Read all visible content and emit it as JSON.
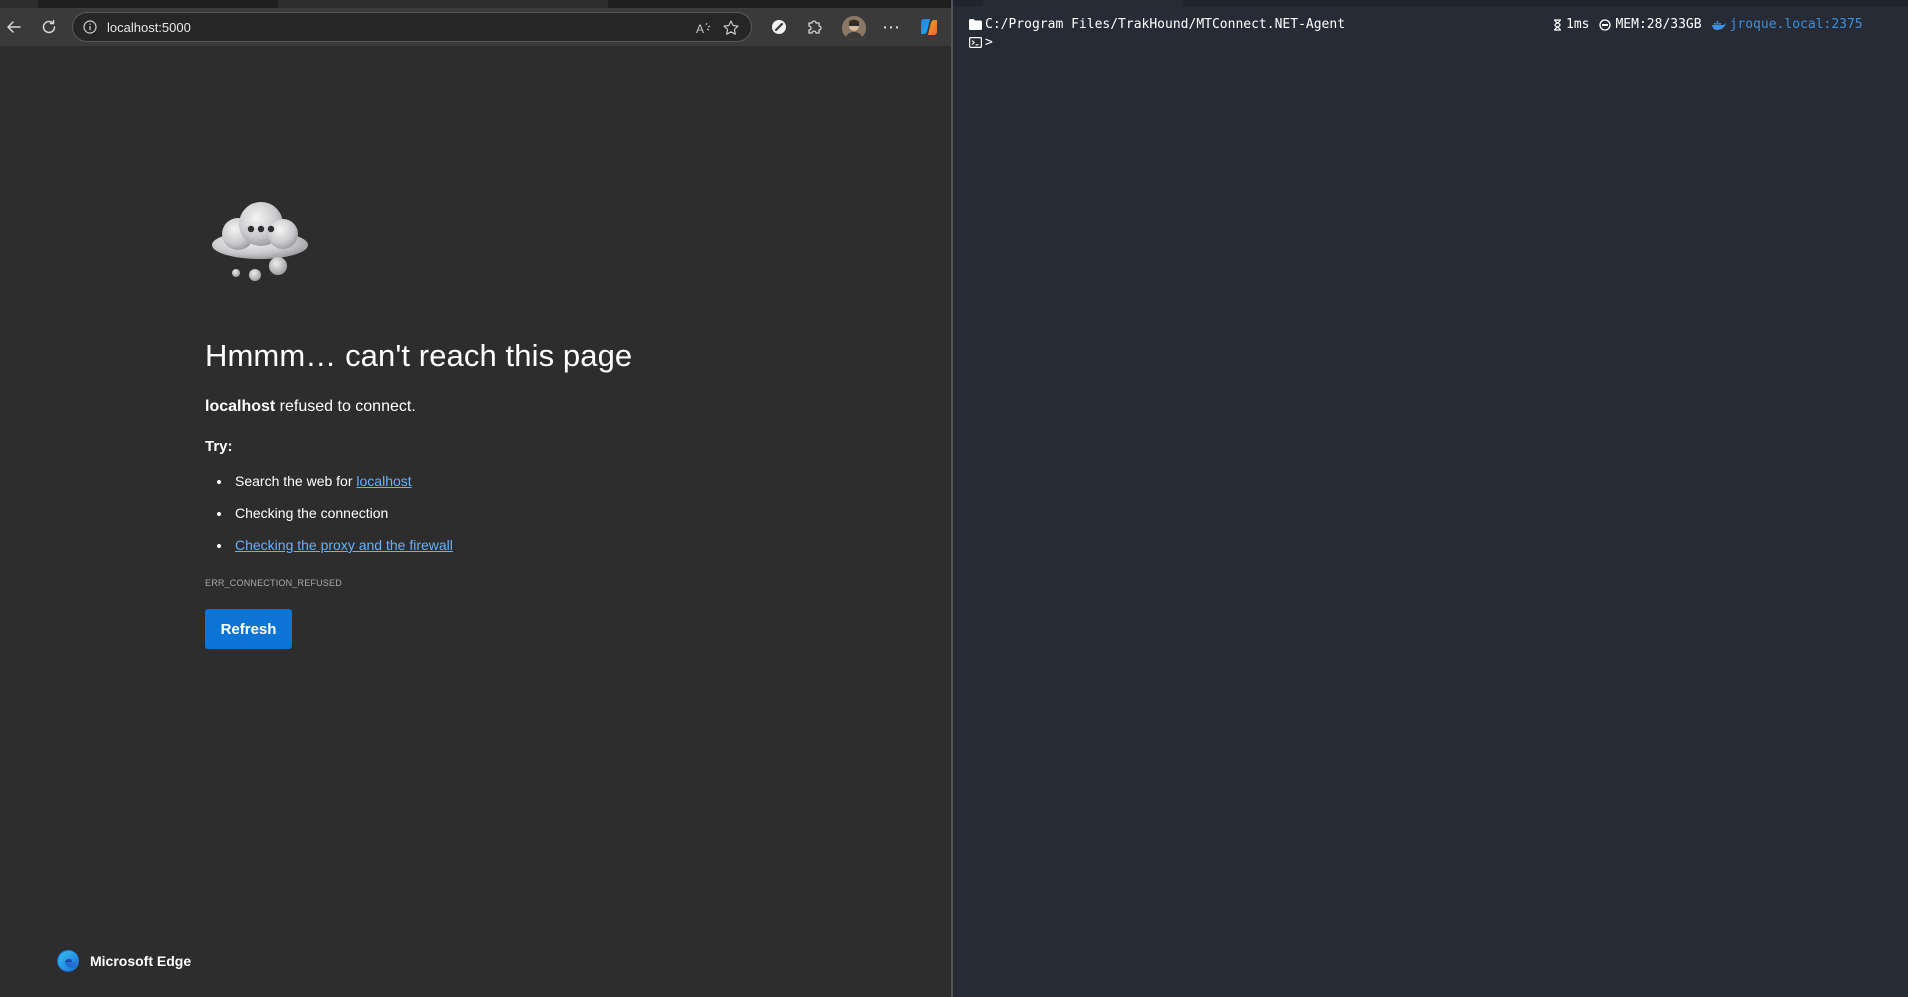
{
  "browser": {
    "url": "localhost:5000",
    "icons": {
      "back": "arrow-left-icon",
      "refresh": "refresh-icon",
      "site_info": "info-circle-icon",
      "read_aloud": "read-aloud-icon",
      "favorite": "star-icon",
      "tracking": "tracking-prevention-icon",
      "extensions": "puzzle-icon",
      "more": "more-dots-icon",
      "copilot": "copilot-icon"
    },
    "more_glyph": "⋯",
    "accent_color": "#0b74d4",
    "link_color": "#6ab0f5"
  },
  "error_page": {
    "title": "Hmmm… can't reach this page",
    "host": "localhost",
    "description_suffix": " refused to connect.",
    "try_label": "Try:",
    "suggestions": {
      "search_prefix": "Search the web for ",
      "search_link": "localhost",
      "check_connection": "Checking the connection",
      "check_proxy": "Checking the proxy and the firewall"
    },
    "error_code": "ERR_CONNECTION_REFUSED",
    "refresh_label": "Refresh",
    "brand_name": "Microsoft Edge"
  },
  "terminal": {
    "path": "C:/Program Files/TrakHound/MTConnect.NET-Agent",
    "duration": "1ms",
    "memory": "MEM:28/33GB",
    "host_port": "jroque.local:2375",
    "prompt_char": ">",
    "background_color": "#262b35",
    "host_color": "#3d8fe0"
  }
}
